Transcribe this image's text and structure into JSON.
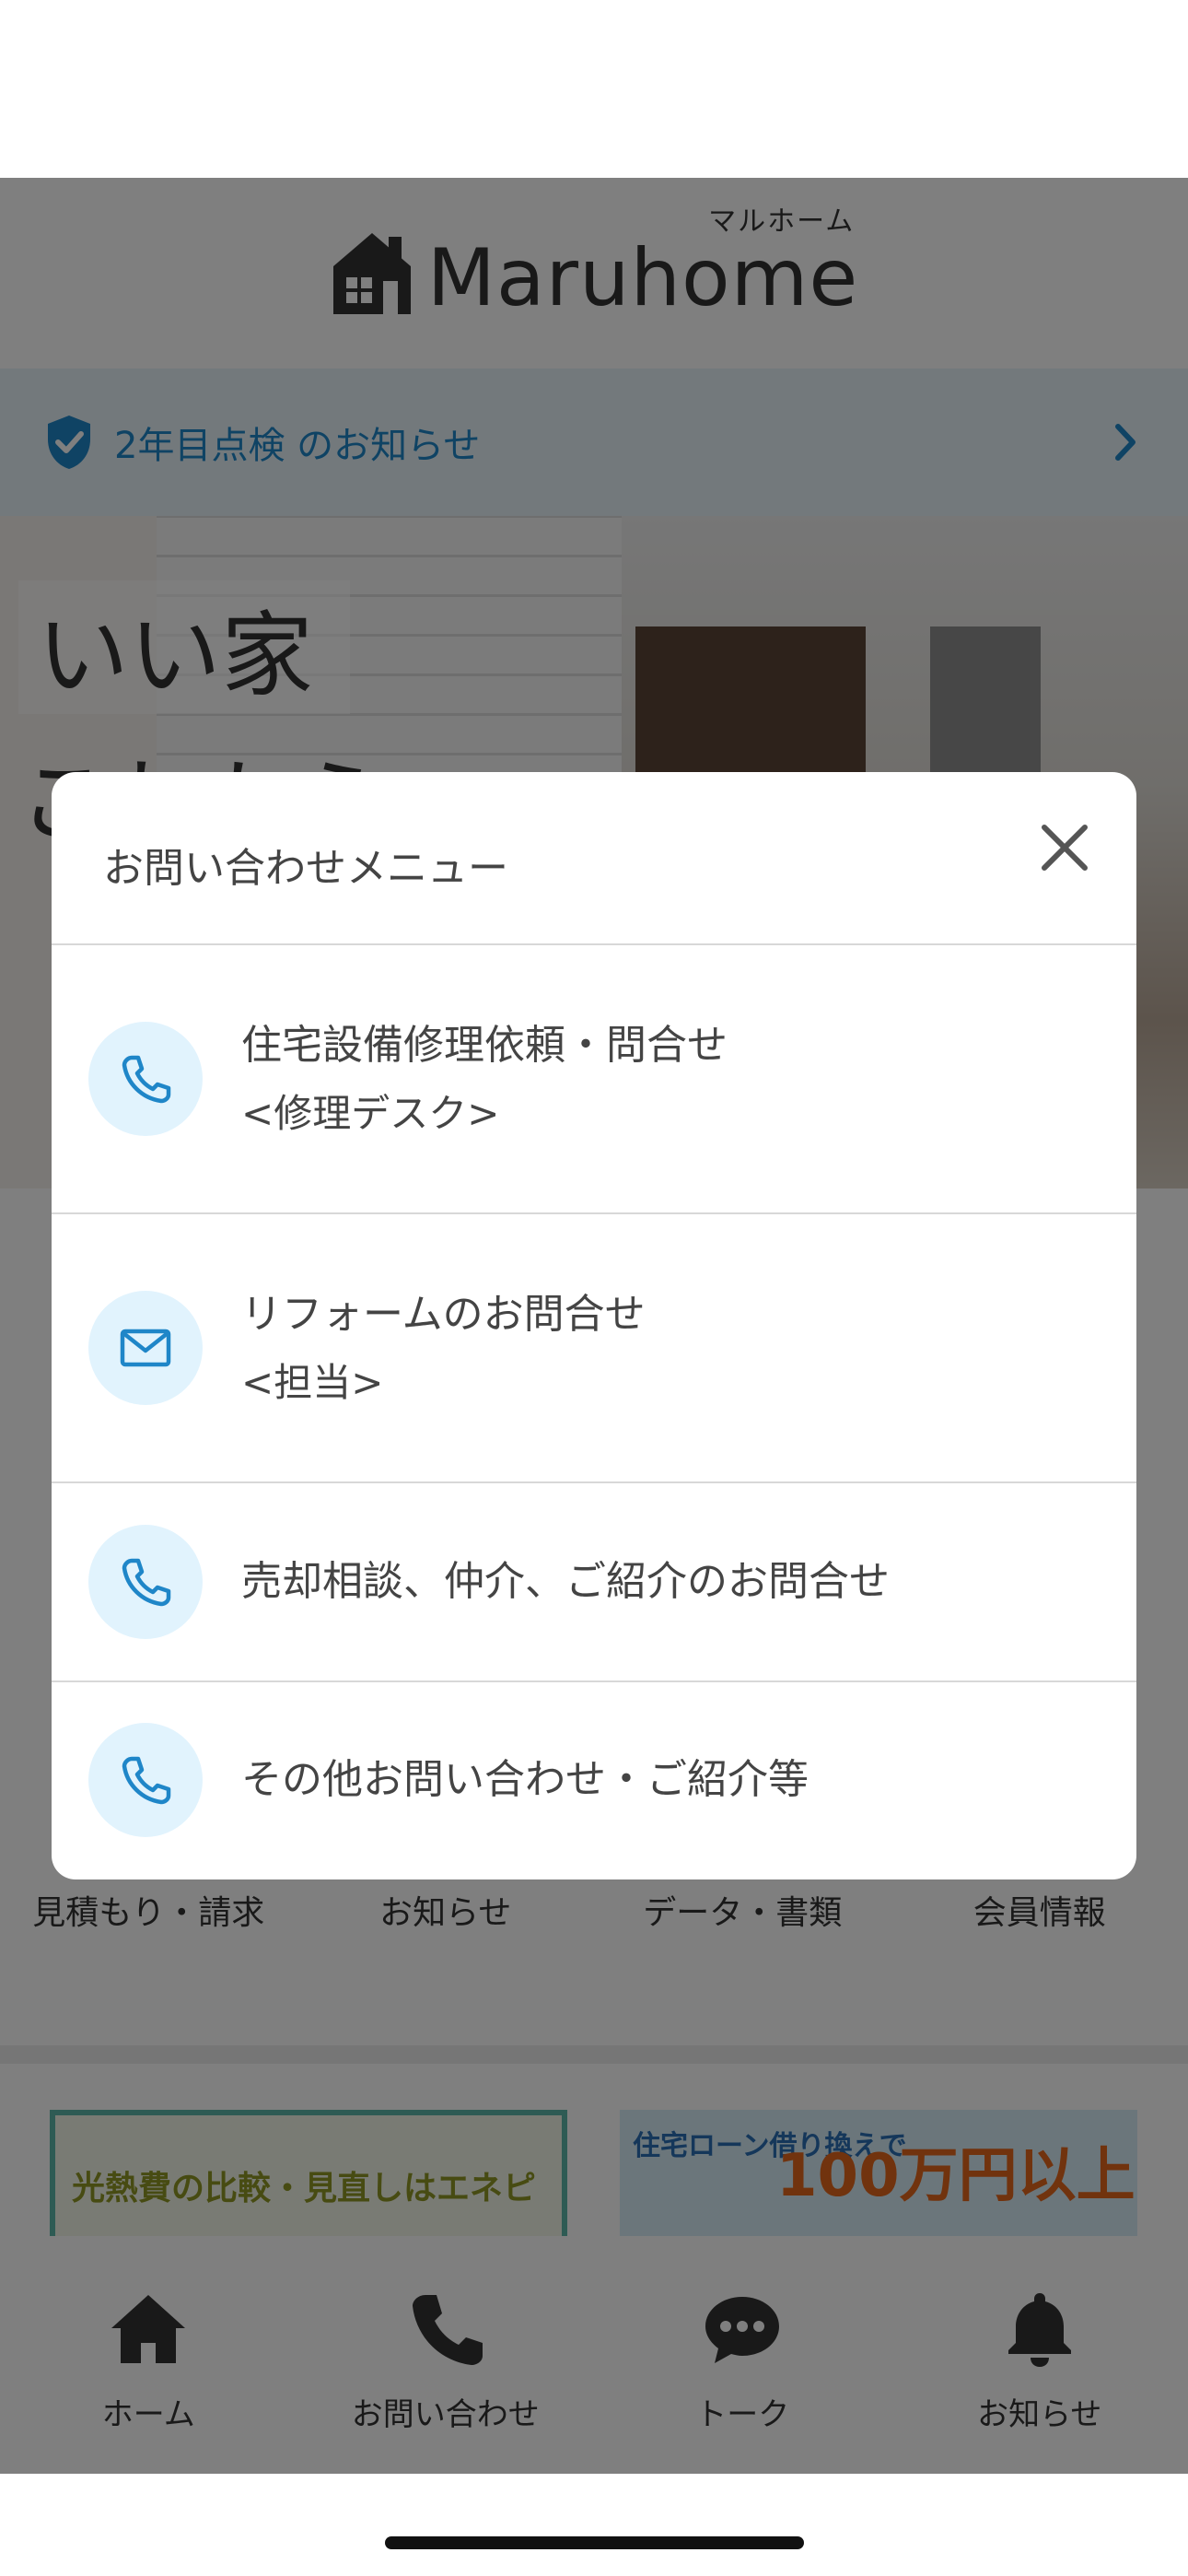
{
  "app": {
    "logo": {
      "name": "Maruhome",
      "kana": "マルホーム"
    }
  },
  "notice": {
    "text": "2年目点検 のお知らせ"
  },
  "hero": {
    "title_line1": "いい家",
    "title_line2": "これから"
  },
  "sections": {
    "labels": [
      "見積もり・請求",
      "お知らせ",
      "データ・書類",
      "会員情報"
    ]
  },
  "banners": {
    "left": {
      "text": "光熱費の比較・見直しはエネピ"
    },
    "right": {
      "small": "住宅ローン借り換えで",
      "big": "100万円以上"
    }
  },
  "tabbar": {
    "items": [
      {
        "label": "ホーム",
        "icon": "home-icon"
      },
      {
        "label": "お問い合わせ",
        "icon": "phone-icon"
      },
      {
        "label": "トーク",
        "icon": "chat-icon"
      },
      {
        "label": "お知らせ",
        "icon": "bell-icon"
      }
    ]
  },
  "modal": {
    "title": "お問い合わせメニュー",
    "items": [
      {
        "label": "住宅設備修理依頼・問合せ",
        "sub": "<修理デスク>",
        "icon": "phone-icon"
      },
      {
        "label": "リフォームのお問合せ",
        "sub": "<担当>",
        "icon": "mail-icon"
      },
      {
        "label": "売却相談、仲介、ご紹介のお問合せ",
        "sub": "",
        "icon": "phone-icon"
      },
      {
        "label": "その他お問い合わせ・ご紹介等",
        "sub": "",
        "icon": "phone-icon"
      }
    ]
  },
  "colors": {
    "accent": "#1f86c8",
    "icon_bg": "#e1f3fd",
    "overlay": "#00000080"
  }
}
